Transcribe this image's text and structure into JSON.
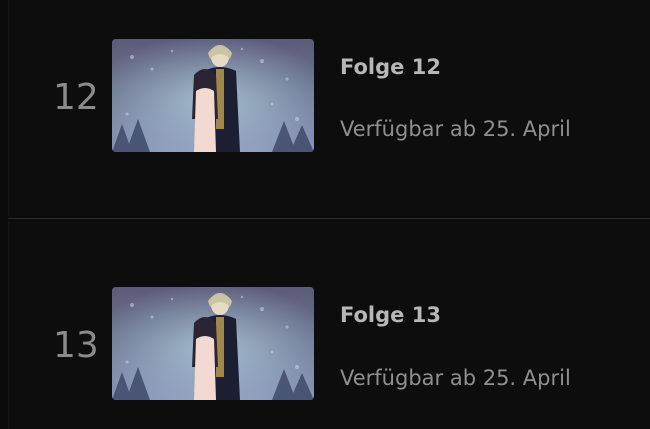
{
  "episodes": [
    {
      "number": "12",
      "title": "Folge 12",
      "availability": "Verfügbar ab 25. April",
      "thumbnail_icon": "episode-thumbnail-image"
    },
    {
      "number": "13",
      "title": "Folge 13",
      "availability": "Verfügbar ab 25. April",
      "thumbnail_icon": "episode-thumbnail-image"
    }
  ],
  "colors": {
    "background": "#0b0b0c",
    "number": "#8b8b8b",
    "title": "#b7b7b7",
    "subtitle": "#8f8f8f",
    "divider": "#2c2c2e"
  }
}
